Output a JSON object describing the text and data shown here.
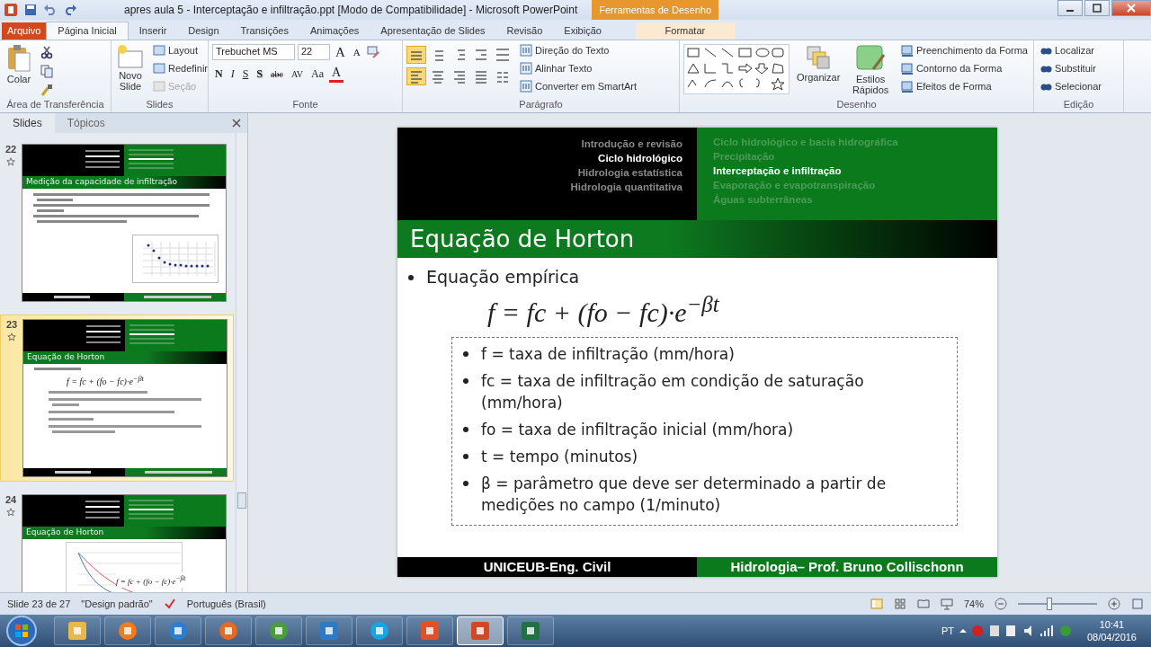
{
  "window": {
    "title": "apres aula 5 - Interceptação e infiltração.ppt [Modo de Compatibilidade] - Microsoft PowerPoint",
    "context_group": "Ferramentas de Desenho"
  },
  "ribbon_tabs": [
    {
      "label": "Arquivo",
      "kind": "file",
      "selected": false
    },
    {
      "label": "Página Inicial",
      "kind": "tab",
      "selected": true
    },
    {
      "label": "Inserir",
      "kind": "tab",
      "selected": false
    },
    {
      "label": "Design",
      "kind": "tab",
      "selected": false
    },
    {
      "label": "Transições",
      "kind": "tab",
      "selected": false
    },
    {
      "label": "Animações",
      "kind": "tab",
      "selected": false
    },
    {
      "label": "Apresentação de Slides",
      "kind": "tab",
      "selected": false
    },
    {
      "label": "Revisão",
      "kind": "tab",
      "selected": false
    },
    {
      "label": "Exibição",
      "kind": "tab",
      "selected": false
    },
    {
      "label": "Formatar",
      "kind": "context",
      "selected": false
    }
  ],
  "clipboard": {
    "label": "Área de Transferência",
    "paste": "Colar"
  },
  "slides_group": {
    "label": "Slides",
    "new_slide": "Novo Slide",
    "commands": [
      {
        "label": "Layout",
        "disabled": false
      },
      {
        "label": "Redefinir",
        "disabled": false
      },
      {
        "label": "Seção",
        "disabled": true
      }
    ]
  },
  "font": {
    "label": "Fonte",
    "font_name": "Trebuchet MS",
    "font_size": "22",
    "grow": "A",
    "shrink": "A",
    "formats": [
      {
        "label": "N",
        "kind": "bold"
      },
      {
        "label": "I",
        "kind": "italic"
      },
      {
        "label": "S",
        "kind": "underline"
      },
      {
        "label": "S",
        "kind": "shadow"
      },
      {
        "label": "abc",
        "kind": "strike"
      },
      {
        "label": "AV",
        "kind": "spacing"
      },
      {
        "label": "Aa",
        "kind": "case"
      }
    ],
    "color_button": "A"
  },
  "paragraph": {
    "label": "Parágrafo",
    "toggles": [
      {
        "kind": "bullets",
        "selected": true
      },
      {
        "kind": "numbering",
        "selected": false
      },
      {
        "kind": "outdent",
        "selected": false
      },
      {
        "kind": "indent",
        "selected": false
      },
      {
        "kind": "spacing",
        "selected": false
      },
      {
        "kind": "left",
        "selected": true
      },
      {
        "kind": "center",
        "selected": false
      },
      {
        "kind": "right",
        "selected": false
      },
      {
        "kind": "justify",
        "selected": false
      },
      {
        "kind": "columns",
        "selected": false
      }
    ],
    "commands": [
      "Direção do Texto",
      "Alinhar Texto",
      "Converter em SmartArt"
    ]
  },
  "drawing": {
    "label": "Desenho",
    "arrange": "Organizar",
    "quick_styles": "Estilos Rápidos",
    "commands": [
      "Preenchimento da Forma",
      "Contorno da Forma",
      "Efeitos de Forma"
    ]
  },
  "editing": {
    "label": "Edição",
    "commands": [
      "Localizar",
      "Substituir",
      "Selecionar"
    ]
  },
  "pane": {
    "tabs": [
      {
        "label": "Slides",
        "selected": true
      },
      {
        "label": "Tópicos",
        "selected": false
      }
    ],
    "thumbnails": [
      {
        "number": "22",
        "selected": false,
        "kind": "text_chart",
        "title": "Medição da capacidade de infiltração"
      },
      {
        "number": "23",
        "selected": true,
        "kind": "formula",
        "title": "Equação de Horton",
        "formula": "f = fc + (fo − fc)·e$^{−βt}$"
      },
      {
        "number": "24",
        "selected": false,
        "kind": "curve_chart",
        "title": "Equação de Horton",
        "formula": "f = fc + (fo − fc)·e$^{−βt}$"
      }
    ]
  },
  "slide": {
    "nav_left": [
      {
        "label": "Introdução e revisão",
        "current": false
      },
      {
        "label": "Ciclo hidrológico",
        "current": true
      },
      {
        "label": "Hidrologia estatística",
        "current": false
      },
      {
        "label": "Hidrologia quantitativa",
        "current": false
      }
    ],
    "nav_right": [
      {
        "label": "Ciclo hidrológico e bacia hidrográfica",
        "current": false
      },
      {
        "label": "Precipitação",
        "current": false
      },
      {
        "label": "Interceptação e infiltração",
        "current": true
      },
      {
        "label": "Evaporação e evapotranspiração",
        "current": false
      },
      {
        "label": "Águas subterrâneas",
        "current": false
      }
    ],
    "title": "Equação de Horton",
    "bullet": "Equação empírica",
    "formula": "f = fc + (fo − fc)·e$^{−βt}$",
    "definitions": [
      "f = taxa de infiltração (mm/hora)",
      "fc = taxa de infiltração em condição de saturação (mm/hora)",
      "fo = taxa de infiltração inicial (mm/hora)",
      "t = tempo (minutos)",
      "β = parâmetro que deve ser determinado a partir de medições no campo (1/minuto)"
    ],
    "footer_left": "UNICEUB-Eng. Civil",
    "footer_right": "Hidrologia– Prof. Bruno Collischonn"
  },
  "status_bar": {
    "slide_info": "Slide 23 de 27",
    "theme": "\"Design padrão\"",
    "language": "Português (Brasil)",
    "zoom": "74%",
    "zoom_slider": {
      "level": 0.4
    }
  },
  "taskbar": {
    "apps": [
      {
        "kind": "explorer",
        "active": false
      },
      {
        "kind": "media",
        "active": false
      },
      {
        "kind": "ie",
        "active": false
      },
      {
        "kind": "firefox",
        "active": false
      },
      {
        "kind": "chrome",
        "active": false
      },
      {
        "kind": "lync",
        "active": false
      },
      {
        "kind": "skype",
        "active": false
      },
      {
        "kind": "office",
        "active": false
      },
      {
        "kind": "powerpoint",
        "active": true
      },
      {
        "kind": "excel",
        "active": false
      }
    ],
    "language": "PT",
    "time": "10:41",
    "date": "08/04/2016"
  }
}
